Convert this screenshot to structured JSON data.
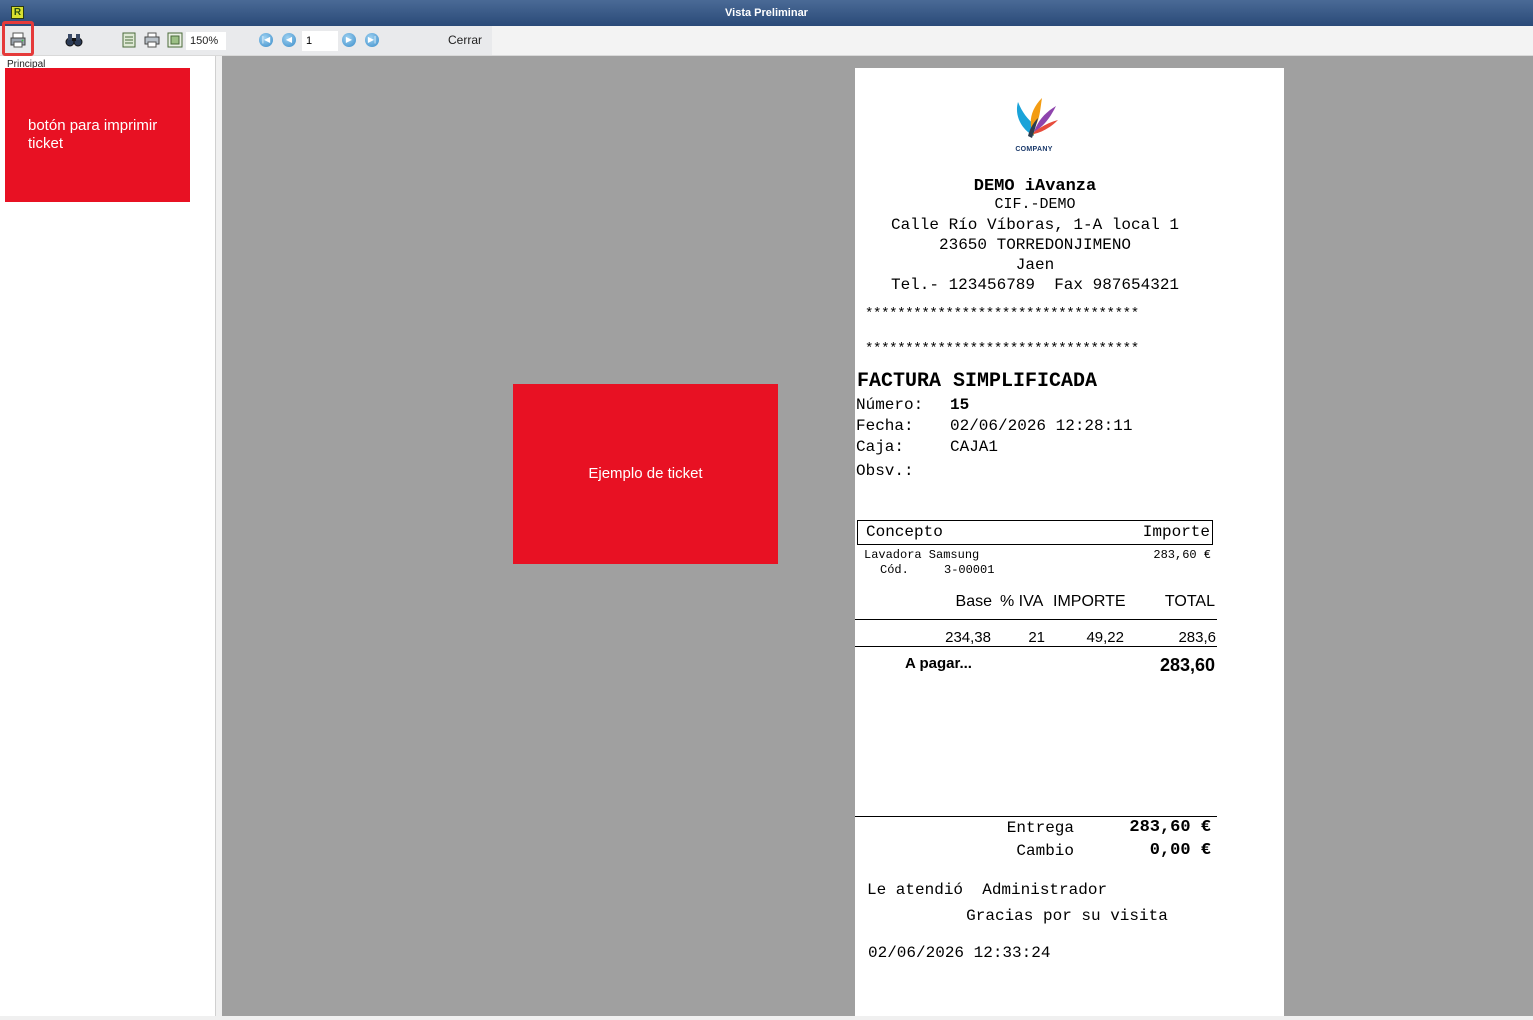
{
  "window": {
    "title": "Vista Preliminar",
    "app_icon": "R"
  },
  "toolbar": {
    "zoom": "150%",
    "page": "1",
    "close_label": "Cerrar"
  },
  "left_panel": {
    "label": "Principal"
  },
  "annotations": {
    "print_button_note": "botón para imprimir ticket",
    "ticket_note": "Ejemplo de ticket"
  },
  "ticket": {
    "logo_text": "COMPANY",
    "company_name": "DEMO iAvanza",
    "cif": "CIF.-DEMO",
    "address": "Calle Río Víboras, 1-A local 1",
    "city": "23650 TORREDONJIMENO",
    "province": "Jaen",
    "phones": "Tel.- 123456789  Fax 987654321",
    "stars_1": "**********************************",
    "stars_2": "**********************************",
    "doc_type": "FACTURA SIMPLIFICADA",
    "numero_label": "Número:",
    "numero_value": "15",
    "fecha_label": "Fecha:",
    "fecha_value": "02/06/2026 12:28:11",
    "caja_label": "Caja:",
    "caja_value": "CAJA1",
    "obsv_label": "Obsv.:",
    "concepto_header": "Concepto",
    "importe_header": "Importe",
    "item_name": "Lavadora Samsung",
    "item_price": "283,60 €",
    "item_code_label": "Cód.",
    "item_code": "3-00001",
    "tax_headers": {
      "base": "Base",
      "iva": "% IVA",
      "importe": "IMPORTE",
      "total": "TOTAL"
    },
    "tax_values": {
      "base": "234,38",
      "iva": "21",
      "importe": "49,22",
      "total": "283,6"
    },
    "a_pagar_label": "A pagar...",
    "a_pagar_value": "283,60",
    "entrega_label": "Entrega",
    "entrega_value": "283,60 €",
    "cambio_label": "Cambio",
    "cambio_value": "0,00 €",
    "atendio": "Le atendió  Administrador",
    "gracias": "Gracias por su visita",
    "print_date": "02/06/2026 12:33:24"
  },
  "colors": {
    "annotation": "#e81123",
    "preview_bg": "#a0a0a0",
    "highlight": "#e53a3a"
  }
}
